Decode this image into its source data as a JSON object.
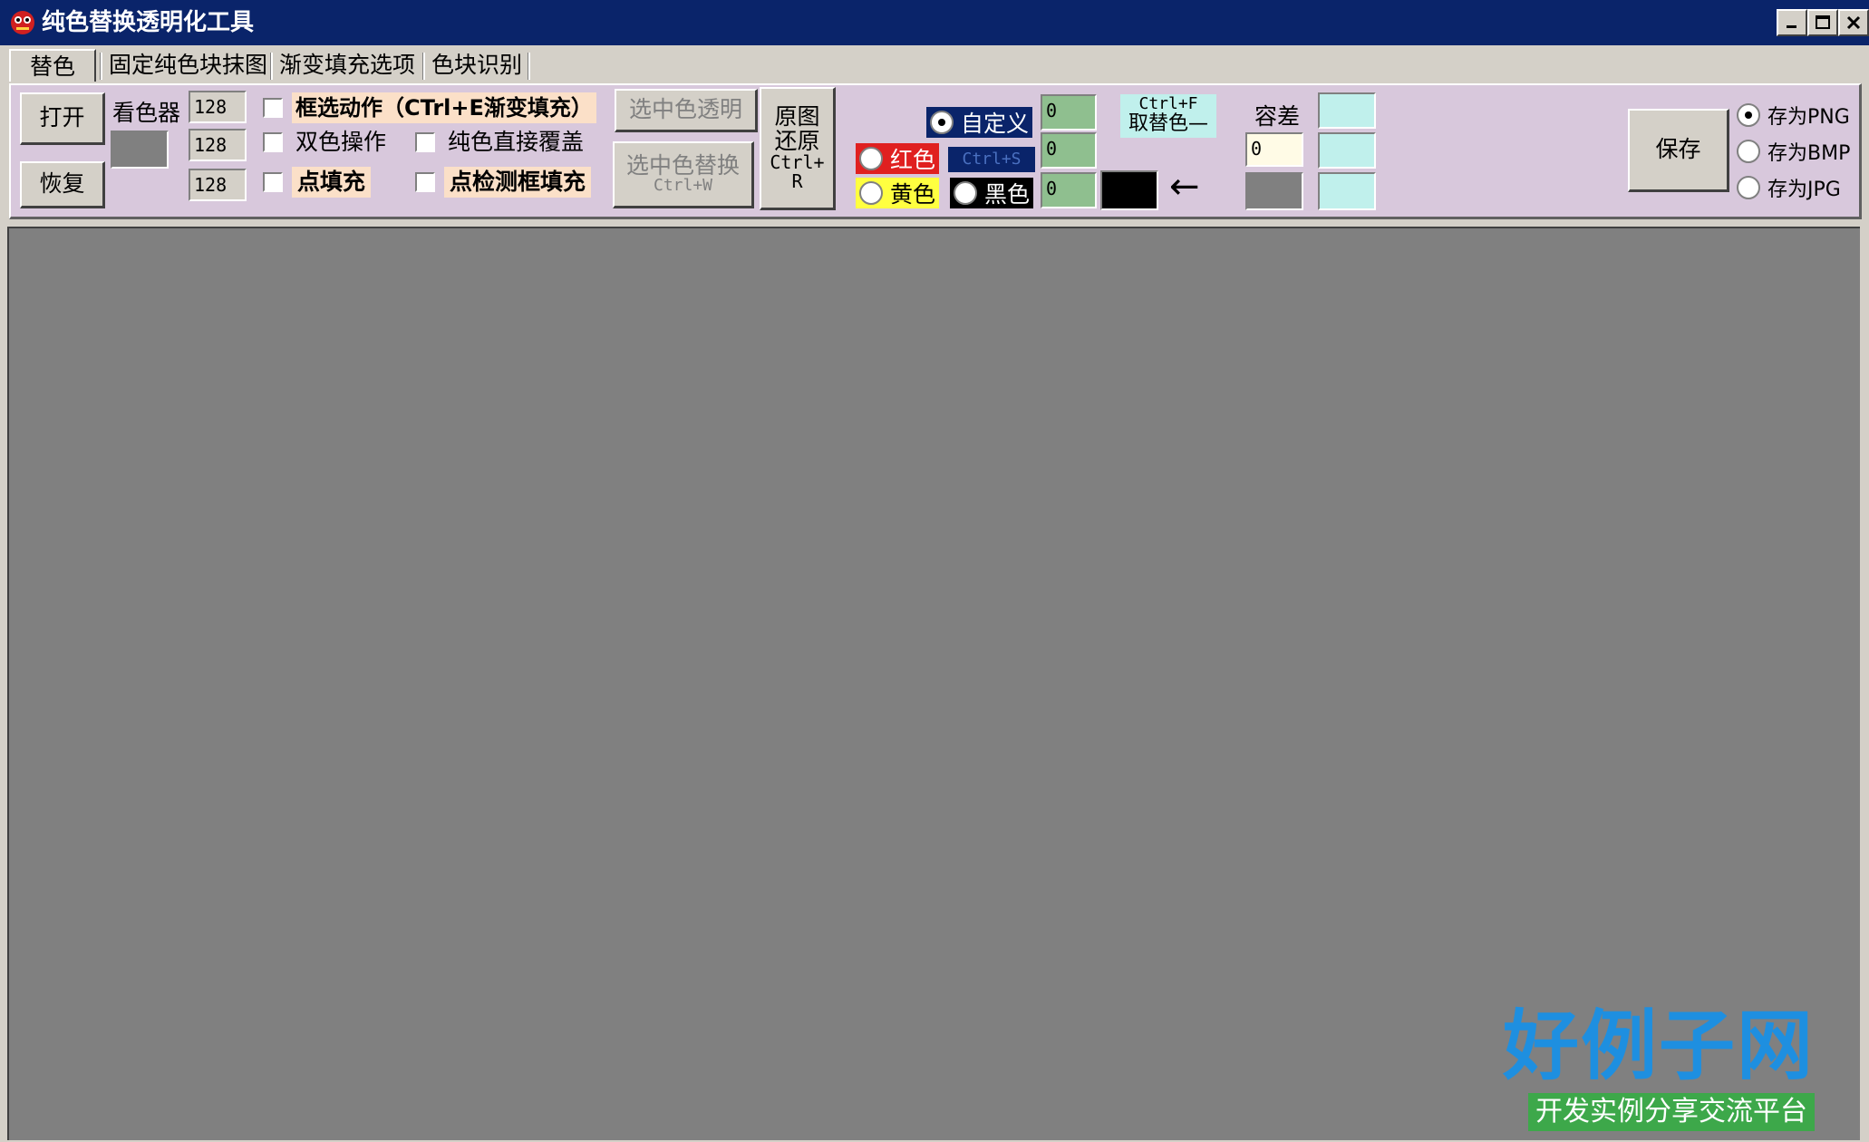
{
  "window": {
    "title": "纯色替换透明化工具"
  },
  "tabs": [
    {
      "label": "替色",
      "active": true
    },
    {
      "label": "固定纯色块抹图",
      "active": false
    },
    {
      "label": "渐变填充选项",
      "active": false
    },
    {
      "label": "色块识别",
      "active": false
    }
  ],
  "toolbar": {
    "open_label": "打开",
    "restore_label": "恢复",
    "picker_label": "看色器",
    "rgb_values": [
      "128",
      "128",
      "128"
    ],
    "checkboxes": {
      "box_action": "框选动作（CTrl+E渐变填充）",
      "dual_color": "双色操作",
      "pure_cover": "纯色直接覆盖",
      "point_fill": "点填充",
      "point_detect": "点检测框填充"
    },
    "select_transparent_label": "选中色透明",
    "select_replace_label": "选中色替换",
    "select_replace_shortcut": "Ctrl+W",
    "restore_original_label": "原图还原",
    "restore_original_shortcut": "Ctrl+R",
    "radios": {
      "custom": "自定义",
      "red": "红色",
      "yellow": "黄色",
      "black": "黑色"
    },
    "ctrl_s_label": "Ctrl+S",
    "color_values": [
      "0",
      "0",
      "0"
    ],
    "ctrl_f_line1": "Ctrl+F",
    "ctrl_f_line2": "取替色—",
    "arrow": "←",
    "tolerance_label": "容差",
    "tolerance_value": "0",
    "save_label": "保存",
    "save_formats": [
      "存为PNG",
      "存为BMP",
      "存为JPG"
    ]
  },
  "watermark": {
    "logo": "好例子网",
    "subtitle": "开发实例分享交流平台"
  },
  "colors": {
    "titlebar": "#0a246a",
    "panel": "#d8c8dc",
    "canvas": "#808080",
    "red_radio": "#e02020",
    "yellow_radio": "#ffff40",
    "ctrl_s_bg": "#0a246a",
    "green_field": "#8fbf8f",
    "cyan_field": "#c0f0ec"
  }
}
